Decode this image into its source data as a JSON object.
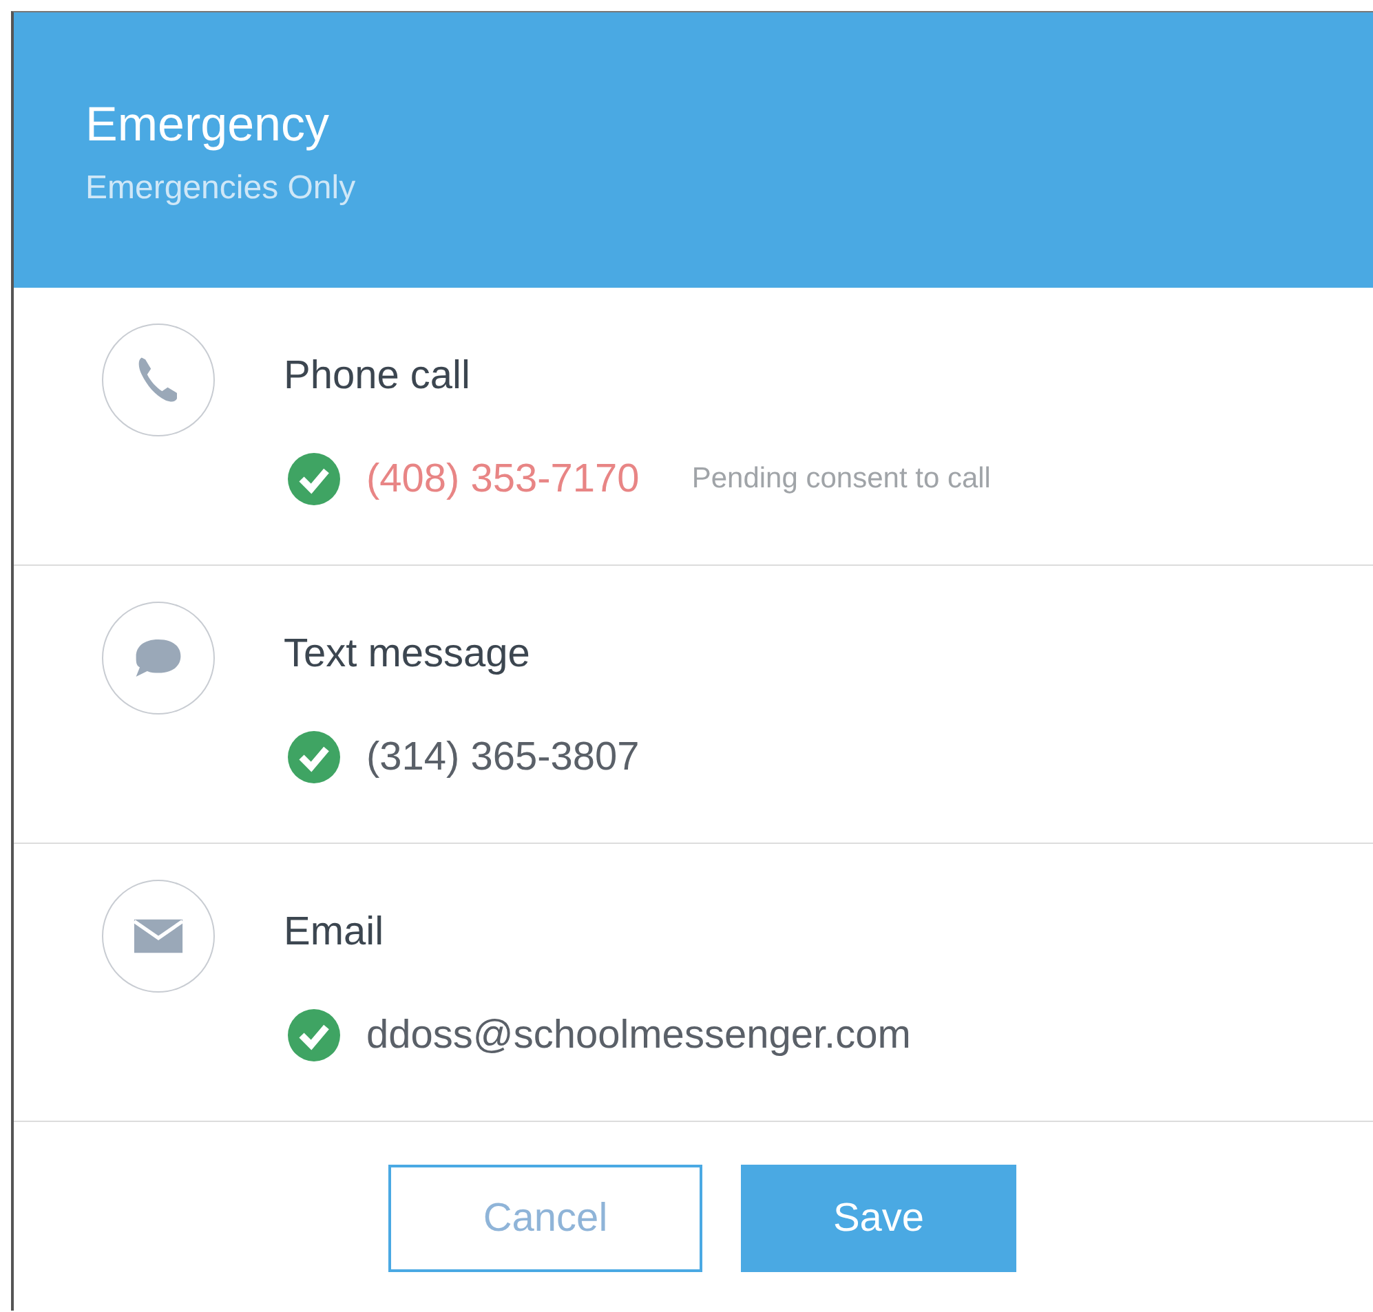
{
  "header": {
    "title": "Emergency",
    "subtitle": "Emergencies Only"
  },
  "methods": [
    {
      "kind": "phone",
      "label": "Phone call",
      "value": "(408) 353-7170",
      "pending": true,
      "note": "Pending consent to call"
    },
    {
      "kind": "text",
      "label": "Text message",
      "value": "(314) 365-3807",
      "pending": false
    },
    {
      "kind": "email",
      "label": "Email",
      "value": "ddoss@schoolmessenger.com",
      "pending": false
    }
  ],
  "buttons": [
    {
      "kind": "secondary",
      "label": "Cancel"
    },
    {
      "kind": "primary",
      "label": "Save"
    }
  ]
}
